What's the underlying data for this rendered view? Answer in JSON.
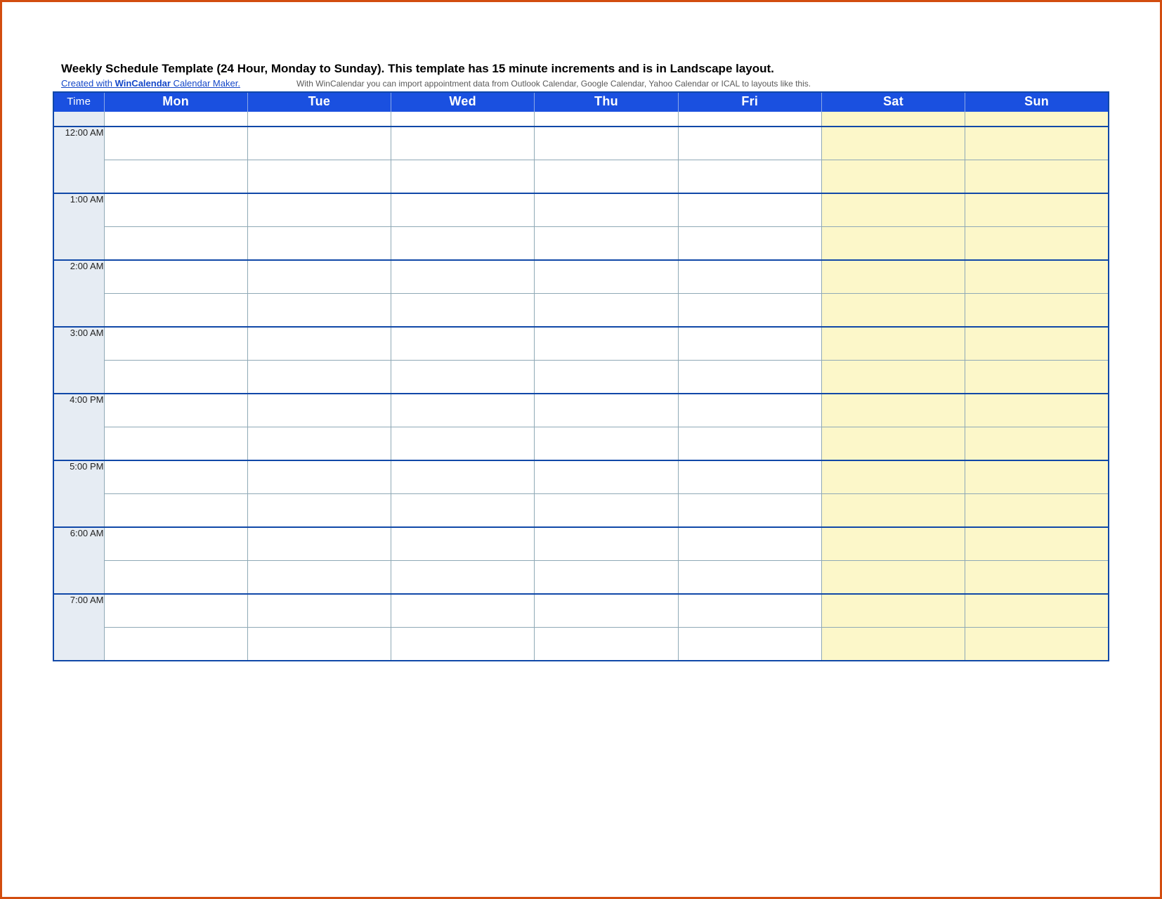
{
  "title": "Weekly Schedule Template (24 Hour, Monday to Sunday).  This template has 15 minute increments and is in Landscape layout.",
  "link_prefix": "Created with ",
  "link_brand": "WinCalendar",
  "link_suffix": " Calendar Maker.",
  "footnote": "With WinCalendar you can import appointment data from Outlook Calendar, Google Calendar, Yahoo Calendar or ICAL to layouts like this.",
  "headers": {
    "time": "Time",
    "mon": "Mon",
    "tue": "Tue",
    "wed": "Wed",
    "thu": "Thu",
    "fri": "Fri",
    "sat": "Sat",
    "sun": "Sun"
  },
  "hours": [
    "12:00 AM",
    "1:00 AM",
    "2:00 AM",
    "3:00 AM",
    "4:00 PM",
    "5:00 PM",
    "6:00 AM",
    "7:00 AM"
  ]
}
